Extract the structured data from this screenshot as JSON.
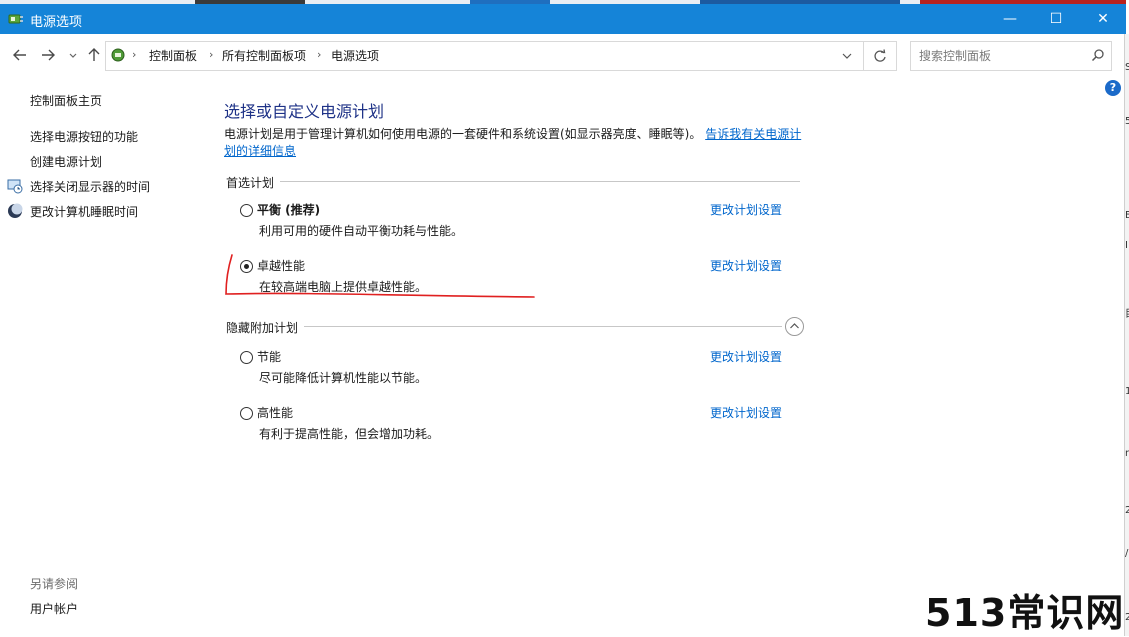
{
  "window": {
    "title": "电源选项",
    "controls": {
      "minimize": "—",
      "maximize": "☐",
      "close": "✕"
    }
  },
  "navigation": {
    "back_icon": "arrow-left-icon",
    "forward_icon": "arrow-right-icon",
    "recent_icon": "chevron-down-icon",
    "up_icon": "arrow-up-icon",
    "breadcrumbs": [
      "控制面板",
      "所有控制面板项",
      "电源选项"
    ],
    "refresh_icon": "refresh-icon",
    "search_placeholder": "搜索控制面板"
  },
  "sidebar": {
    "home_link": "控制面板主页",
    "items": [
      {
        "label": "选择电源按钮的功能",
        "icon": ""
      },
      {
        "label": "创建电源计划",
        "icon": ""
      },
      {
        "label": "选择关闭显示器的时间",
        "icon": "monitor-clock-icon"
      },
      {
        "label": "更改计算机睡眠时间",
        "icon": "moon-icon"
      }
    ],
    "see_also_label": "另请参阅",
    "see_also_items": [
      "用户帐户"
    ]
  },
  "main": {
    "title": "选择或自定义电源计划",
    "description": "电源计划是用于管理计算机如何使用电源的一套硬件和系统设置(如显示器亮度、睡眠等)。",
    "description_link": "告诉我有关电源计划的详细信息",
    "preferred_group_label": "首选计划",
    "hidden_group_label": "隐藏附加计划",
    "preferred_plans": [
      {
        "name": "平衡 (推荐)",
        "description": "利用可用的硬件自动平衡功耗与性能。",
        "link": "更改计划设置",
        "selected": false
      },
      {
        "name": "卓越性能",
        "description": "在较高端电脑上提供卓越性能。",
        "link": "更改计划设置",
        "selected": true
      }
    ],
    "hidden_plans": [
      {
        "name": "节能",
        "description": "尽可能降低计算机性能以节能。",
        "link": "更改计划设置",
        "selected": false
      },
      {
        "name": "高性能",
        "description": "有利于提高性能，但会增加功耗。",
        "link": "更改计划设置",
        "selected": false
      }
    ]
  },
  "help_icon": "?",
  "watermark": "513常识网",
  "annotation_color": "#e02020",
  "accent_color": "#1584d8",
  "link_color": "#0066cc",
  "title_color": "#1e3287",
  "right_edge_chars": [
    "S",
    "5",
    "E",
    "I",
    "目",
    "1",
    "n",
    "2",
    "/",
    "2"
  ]
}
